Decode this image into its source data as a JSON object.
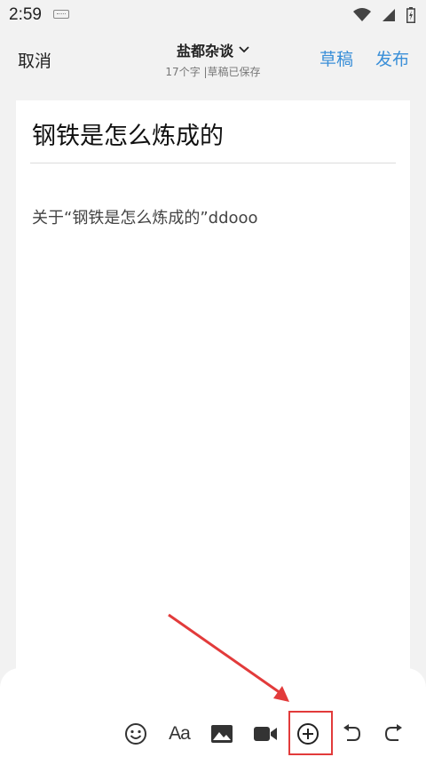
{
  "status_bar": {
    "time": "2:59"
  },
  "header": {
    "cancel_label": "取消",
    "title": "盐都杂谈",
    "subtitle": "17个字 |草稿已保存",
    "draft_label": "草稿",
    "publish_label": "发布"
  },
  "editor": {
    "title": "钢铁是怎么炼成的",
    "body": "关于“钢铁是怎么炼成的”ddooo"
  },
  "toolbar": {
    "font_label": "Aa"
  },
  "colors": {
    "accent": "#3a8fd8",
    "highlight": "#e23b3b"
  }
}
